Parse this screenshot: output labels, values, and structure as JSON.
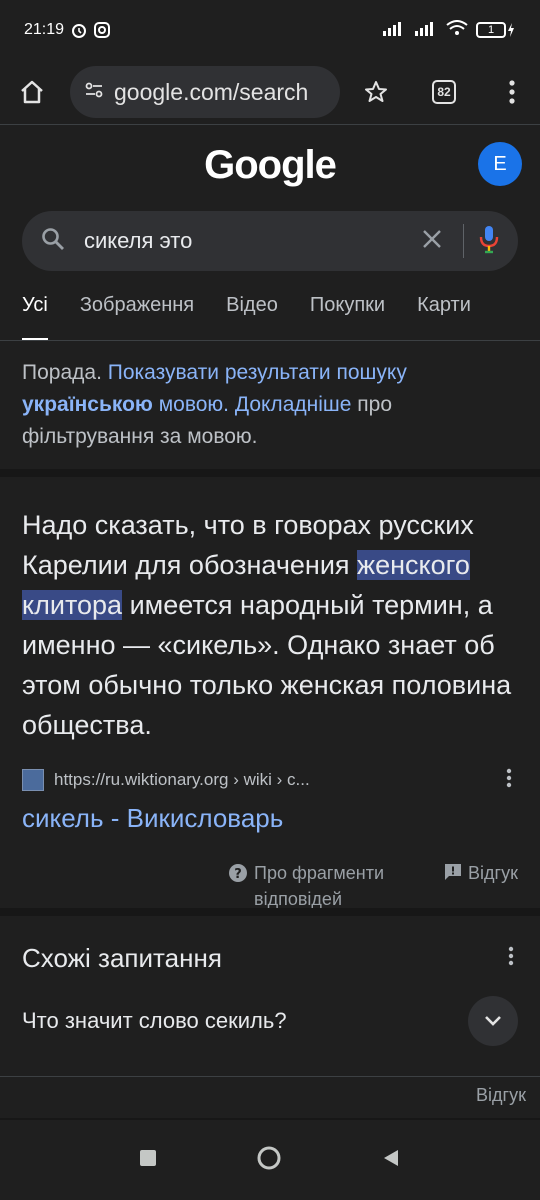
{
  "status": {
    "time": "21:19",
    "battery": "1"
  },
  "browser": {
    "url": "google.com/search",
    "tab_count": "82"
  },
  "google": {
    "logo": "Google",
    "avatar_letter": "E",
    "query": "сикеля это"
  },
  "tabs": [
    "Усі",
    "Зображення",
    "Відео",
    "Покупки",
    "Карти"
  ],
  "tip": {
    "prefix": "Порада.",
    "link1": "Показувати результати пошуку",
    "bold": "українською",
    "link2": "мовою.",
    "link3": "Докладніше",
    "suffix": "про фільтрування за мовою."
  },
  "snippet": {
    "text_before": "Надо сказать, что в говорах русских Карелии для обозначения ",
    "highlight1": "женского",
    "highlight2": "клитора",
    "text_after": " имеется народный термин, а именно — «сикель». Однако знает об этом обычно только женская половина общества.",
    "source_url": "https://ru.wiktionary.org › wiki › с...",
    "title": "сикель - Викисловарь",
    "about_label": "Про фрагменти відповідей",
    "feedback_label": "Відгук"
  },
  "related": {
    "title": "Схожі запитання",
    "question": "Что значит слово секиль?",
    "feedback_label": "Відгук"
  },
  "colors": {
    "background": "#1f1f1f",
    "link": "#8ab4f8",
    "highlight": "#394a86",
    "avatar": "#1a73e8"
  }
}
